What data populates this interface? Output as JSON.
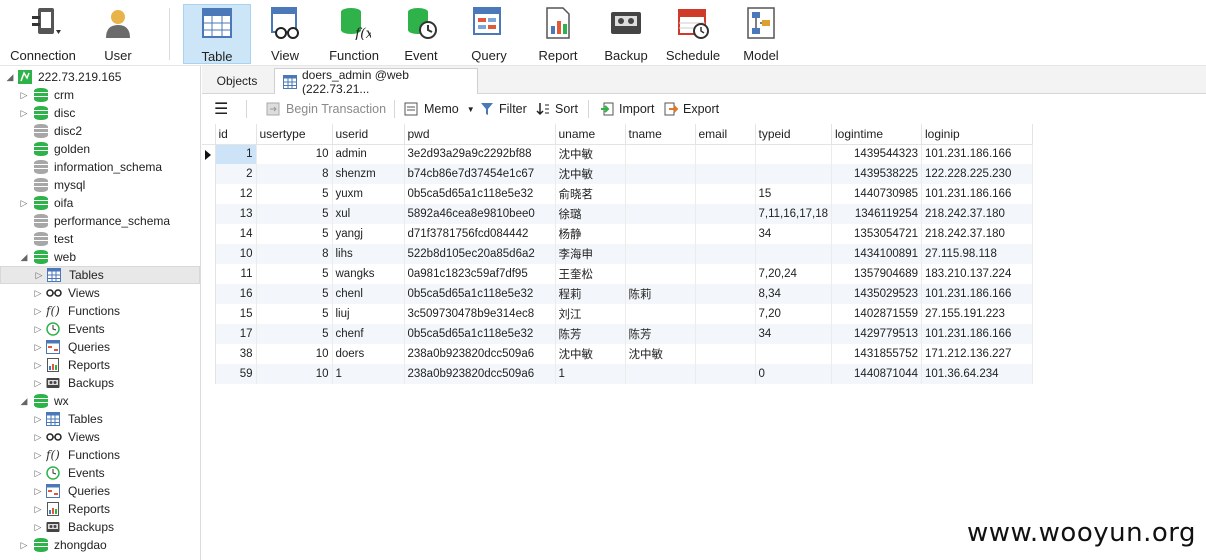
{
  "toolbar": {
    "connection": "Connection",
    "user": "User",
    "table": "Table",
    "view": "View",
    "function": "Function",
    "event": "Event",
    "query": "Query",
    "report": "Report",
    "backup": "Backup",
    "schedule": "Schedule",
    "model": "Model"
  },
  "sidebar": {
    "connection": "222.73.219.165",
    "databases": [
      "crm",
      "disc",
      "disc2",
      "golden",
      "information_schema",
      "mysql",
      "oifa",
      "performance_schema",
      "test",
      "web"
    ],
    "web_children": [
      "Tables",
      "Views",
      "Functions",
      "Events",
      "Queries",
      "Reports",
      "Backups"
    ],
    "wx": "wx",
    "wx_children": [
      "Tables",
      "Views",
      "Functions",
      "Events",
      "Queries",
      "Reports",
      "Backups"
    ],
    "zhongdao": "zhongdao"
  },
  "tabs": {
    "objects": "Objects",
    "active": "doers_admin @web (222.73.21..."
  },
  "subbar": {
    "begin_transaction": "Begin Transaction",
    "memo": "Memo",
    "filter": "Filter",
    "sort": "Sort",
    "import": "Import",
    "export": "Export"
  },
  "table": {
    "columns": [
      "id",
      "usertype",
      "userid",
      "pwd",
      "uname",
      "tname",
      "email",
      "typeid",
      "logintime",
      "loginip"
    ],
    "rows": [
      [
        "1",
        "10",
        "admin",
        "3e2d93a29a9c2292bf88",
        "沈中敏",
        "",
        "",
        "",
        "1439544323",
        "101.231.186.166"
      ],
      [
        "2",
        "8",
        "shenzm",
        "b74cb86e7d37454e1c67",
        "沈中敏",
        "",
        "",
        "",
        "1439538225",
        "122.228.225.230"
      ],
      [
        "12",
        "5",
        "yuxm",
        "0b5ca5d65a1c118e5e32",
        "俞晓茗",
        "",
        "",
        "15",
        "1440730985",
        "101.231.186.166"
      ],
      [
        "13",
        "5",
        "xul",
        "5892a46cea8e9810bee0",
        "徐璐",
        "",
        "",
        "7,11,16,17,18",
        "1346119254",
        "218.242.37.180"
      ],
      [
        "14",
        "5",
        "yangj",
        "d71f3781756fcd084442",
        "杨静",
        "",
        "",
        "34",
        "1353054721",
        "218.242.37.180"
      ],
      [
        "10",
        "8",
        "lihs",
        "522b8d105ec20a85d6a2",
        "李海申",
        "",
        "",
        "",
        "1434100891",
        "27.115.98.118"
      ],
      [
        "11",
        "5",
        "wangks",
        "0a981c1823c59af7df95",
        "王奎松",
        "",
        "",
        "7,20,24",
        "1357904689",
        "183.210.137.224"
      ],
      [
        "16",
        "5",
        "chenl",
        "0b5ca5d65a1c118e5e32",
        "程莉",
        "陈莉",
        "",
        "8,34",
        "1435029523",
        "101.231.186.166"
      ],
      [
        "15",
        "5",
        "liuj",
        "3c509730478b9e314ec8",
        "刘江",
        "",
        "",
        "7,20",
        "1402871559",
        "27.155.191.223"
      ],
      [
        "17",
        "5",
        "chenf",
        "0b5ca5d65a1c118e5e32",
        "陈芳",
        "陈芳",
        "",
        "34",
        "1429779513",
        "101.231.186.166"
      ],
      [
        "38",
        "10",
        "doers",
        "238a0b923820dcc509a6",
        "沈中敏",
        "沈中敏",
        "",
        "",
        "1431855752",
        "171.212.136.227"
      ],
      [
        "59",
        "10",
        "1",
        "238a0b923820dcc509a6",
        "1",
        "",
        "",
        "0",
        "1440871044",
        "101.36.64.234"
      ]
    ]
  },
  "watermark": "www.wooyun.org"
}
